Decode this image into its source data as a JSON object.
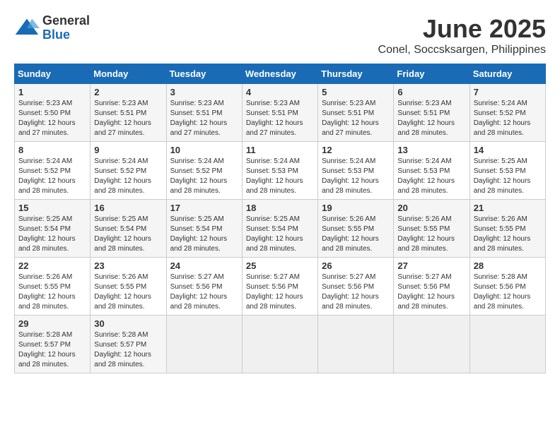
{
  "logo": {
    "general": "General",
    "blue": "Blue"
  },
  "title": "June 2025",
  "subtitle": "Conel, Soccsksargen, Philippines",
  "weekdays": [
    "Sunday",
    "Monday",
    "Tuesday",
    "Wednesday",
    "Thursday",
    "Friday",
    "Saturday"
  ],
  "weeks": [
    [
      {
        "day": "1",
        "sunrise": "5:23 AM",
        "sunset": "5:50 PM",
        "daylight": "12 hours and 27 minutes."
      },
      {
        "day": "2",
        "sunrise": "5:23 AM",
        "sunset": "5:51 PM",
        "daylight": "12 hours and 27 minutes."
      },
      {
        "day": "3",
        "sunrise": "5:23 AM",
        "sunset": "5:51 PM",
        "daylight": "12 hours and 27 minutes."
      },
      {
        "day": "4",
        "sunrise": "5:23 AM",
        "sunset": "5:51 PM",
        "daylight": "12 hours and 27 minutes."
      },
      {
        "day": "5",
        "sunrise": "5:23 AM",
        "sunset": "5:51 PM",
        "daylight": "12 hours and 27 minutes."
      },
      {
        "day": "6",
        "sunrise": "5:23 AM",
        "sunset": "5:51 PM",
        "daylight": "12 hours and 28 minutes."
      },
      {
        "day": "7",
        "sunrise": "5:24 AM",
        "sunset": "5:52 PM",
        "daylight": "12 hours and 28 minutes."
      }
    ],
    [
      {
        "day": "8",
        "sunrise": "5:24 AM",
        "sunset": "5:52 PM",
        "daylight": "12 hours and 28 minutes."
      },
      {
        "day": "9",
        "sunrise": "5:24 AM",
        "sunset": "5:52 PM",
        "daylight": "12 hours and 28 minutes."
      },
      {
        "day": "10",
        "sunrise": "5:24 AM",
        "sunset": "5:52 PM",
        "daylight": "12 hours and 28 minutes."
      },
      {
        "day": "11",
        "sunrise": "5:24 AM",
        "sunset": "5:53 PM",
        "daylight": "12 hours and 28 minutes."
      },
      {
        "day": "12",
        "sunrise": "5:24 AM",
        "sunset": "5:53 PM",
        "daylight": "12 hours and 28 minutes."
      },
      {
        "day": "13",
        "sunrise": "5:24 AM",
        "sunset": "5:53 PM",
        "daylight": "12 hours and 28 minutes."
      },
      {
        "day": "14",
        "sunrise": "5:25 AM",
        "sunset": "5:53 PM",
        "daylight": "12 hours and 28 minutes."
      }
    ],
    [
      {
        "day": "15",
        "sunrise": "5:25 AM",
        "sunset": "5:54 PM",
        "daylight": "12 hours and 28 minutes."
      },
      {
        "day": "16",
        "sunrise": "5:25 AM",
        "sunset": "5:54 PM",
        "daylight": "12 hours and 28 minutes."
      },
      {
        "day": "17",
        "sunrise": "5:25 AM",
        "sunset": "5:54 PM",
        "daylight": "12 hours and 28 minutes."
      },
      {
        "day": "18",
        "sunrise": "5:25 AM",
        "sunset": "5:54 PM",
        "daylight": "12 hours and 28 minutes."
      },
      {
        "day": "19",
        "sunrise": "5:26 AM",
        "sunset": "5:55 PM",
        "daylight": "12 hours and 28 minutes."
      },
      {
        "day": "20",
        "sunrise": "5:26 AM",
        "sunset": "5:55 PM",
        "daylight": "12 hours and 28 minutes."
      },
      {
        "day": "21",
        "sunrise": "5:26 AM",
        "sunset": "5:55 PM",
        "daylight": "12 hours and 28 minutes."
      }
    ],
    [
      {
        "day": "22",
        "sunrise": "5:26 AM",
        "sunset": "5:55 PM",
        "daylight": "12 hours and 28 minutes."
      },
      {
        "day": "23",
        "sunrise": "5:26 AM",
        "sunset": "5:55 PM",
        "daylight": "12 hours and 28 minutes."
      },
      {
        "day": "24",
        "sunrise": "5:27 AM",
        "sunset": "5:56 PM",
        "daylight": "12 hours and 28 minutes."
      },
      {
        "day": "25",
        "sunrise": "5:27 AM",
        "sunset": "5:56 PM",
        "daylight": "12 hours and 28 minutes."
      },
      {
        "day": "26",
        "sunrise": "5:27 AM",
        "sunset": "5:56 PM",
        "daylight": "12 hours and 28 minutes."
      },
      {
        "day": "27",
        "sunrise": "5:27 AM",
        "sunset": "5:56 PM",
        "daylight": "12 hours and 28 minutes."
      },
      {
        "day": "28",
        "sunrise": "5:28 AM",
        "sunset": "5:56 PM",
        "daylight": "12 hours and 28 minutes."
      }
    ],
    [
      {
        "day": "29",
        "sunrise": "5:28 AM",
        "sunset": "5:57 PM",
        "daylight": "12 hours and 28 minutes."
      },
      {
        "day": "30",
        "sunrise": "5:28 AM",
        "sunset": "5:57 PM",
        "daylight": "12 hours and 28 minutes."
      },
      null,
      null,
      null,
      null,
      null
    ]
  ]
}
